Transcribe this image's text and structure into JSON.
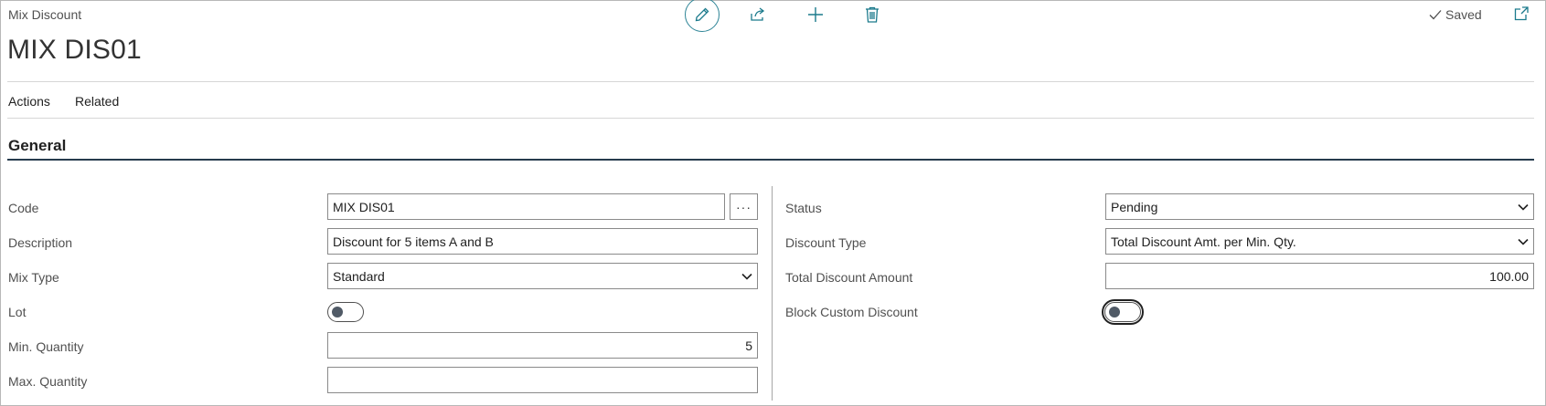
{
  "header": {
    "breadcrumb": "Mix Discount",
    "title": "MIX DIS01",
    "saved_label": "Saved"
  },
  "menu": {
    "actions": "Actions",
    "related": "Related"
  },
  "section": {
    "title": "General"
  },
  "left_fields": {
    "code": {
      "label": "Code",
      "value": "MIX DIS01",
      "assist": "···"
    },
    "description": {
      "label": "Description",
      "value": "Discount for 5 items A and B"
    },
    "mix_type": {
      "label": "Mix Type",
      "value": "Standard"
    },
    "lot": {
      "label": "Lot",
      "value": false
    },
    "min_quantity": {
      "label": "Min. Quantity",
      "value": "5"
    },
    "max_quantity": {
      "label": "Max. Quantity",
      "value": ""
    }
  },
  "right_fields": {
    "status": {
      "label": "Status",
      "value": "Pending"
    },
    "discount_type": {
      "label": "Discount Type",
      "value": "Total Discount Amt. per Min. Qty."
    },
    "total_discount_amount": {
      "label": "Total Discount Amount",
      "value": "100.00"
    },
    "block_custom_discount": {
      "label": "Block Custom Discount",
      "value": false
    }
  },
  "icons": {
    "edit": "pencil-icon",
    "share": "share-icon",
    "add": "plus-icon",
    "delete": "trash-icon",
    "saved": "checkmark-icon",
    "popout": "open-in-new-window-icon",
    "dropdown": "chevron-down-icon"
  },
  "colors": {
    "accent": "#1b7a8c",
    "section_rule": "#263b4d",
    "border": "#8a8a8a"
  }
}
